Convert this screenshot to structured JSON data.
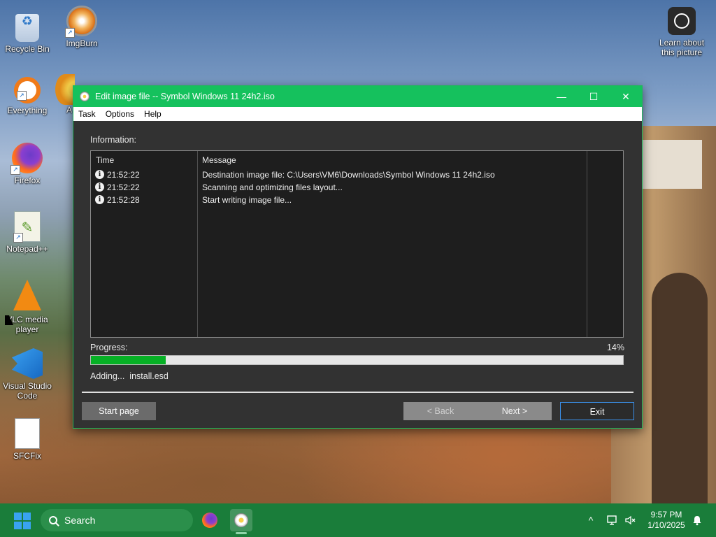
{
  "desktop": {
    "icons": [
      {
        "label": "Recycle Bin",
        "icon": "recycle-bin-icon"
      },
      {
        "label": "ImgBurn",
        "icon": "imgburn-icon"
      },
      {
        "label": "Everything",
        "icon": "everything-icon"
      },
      {
        "label": "A",
        "icon": "app-icon"
      },
      {
        "label": "Firefox",
        "icon": "firefox-icon"
      },
      {
        "label": "Notepad++",
        "icon": "notepadpp-icon"
      },
      {
        "label": "VLC media player",
        "icon": "vlc-icon"
      },
      {
        "label": "Visual Studio Code",
        "icon": "vscode-icon"
      },
      {
        "label": "SFCFix",
        "icon": "file-icon"
      },
      {
        "label": "Learn about this picture",
        "icon": "learn-picture-icon"
      }
    ]
  },
  "window": {
    "title": "Edit image file -- Symbol Windows 11 24h2.iso",
    "controls": {
      "minimize": "—",
      "maximize": "☐",
      "close": "✕"
    },
    "menu": [
      "Task",
      "Options",
      "Help"
    ],
    "info_label": "Information:",
    "log": {
      "columns": [
        "Time",
        "Message"
      ],
      "rows": [
        {
          "time": "21:52:22",
          "message": "Destination image file:  C:\\Users\\VM6\\Downloads\\Symbol Windows 11 24h2.iso",
          "icon": "info-icon"
        },
        {
          "time": "21:52:22",
          "message": "Scanning and optimizing files layout...",
          "icon": "info-icon"
        },
        {
          "time": "21:52:28",
          "message": "Start writing image file...",
          "icon": "info-icon"
        }
      ]
    },
    "progress": {
      "label": "Progress:",
      "percent_text": "14%",
      "value": 0.14
    },
    "status": "Adding...  install.esd",
    "buttons": {
      "start_page": "Start page",
      "back": "< Back",
      "next": "Next >",
      "exit": "Exit"
    }
  },
  "taskbar": {
    "search_placeholder": "Search",
    "apps": [
      "firefox-icon",
      "imgburn-icon"
    ],
    "tray": {
      "chevron": "^",
      "network_icon": "network-icon",
      "volume_icon": "volume-muted-icon"
    },
    "time": "9:57 PM",
    "date": "1/10/2025",
    "bell_icon": "notification-bell-icon"
  },
  "colors": {
    "title_bar": "#15c15d",
    "taskbar": "#1a7d3a",
    "progress_fill": "#06b025",
    "exit_border": "#3a8ee6"
  }
}
